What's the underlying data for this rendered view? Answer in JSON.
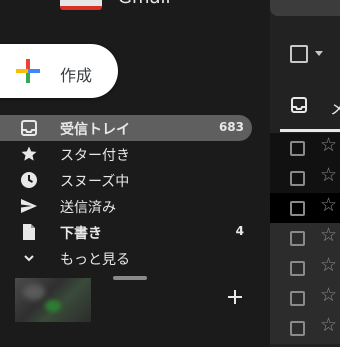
{
  "app": {
    "logo_text": "Gmail"
  },
  "compose": {
    "label": "作成"
  },
  "nav": {
    "items": [
      {
        "label": "受信トレイ",
        "count": "683",
        "active": true,
        "icon": "inbox-icon"
      },
      {
        "label": "スター付き",
        "count": "",
        "active": false,
        "icon": "star-icon"
      },
      {
        "label": "スヌーズ中",
        "count": "",
        "active": false,
        "icon": "clock-icon"
      },
      {
        "label": "送信済み",
        "count": "",
        "active": false,
        "icon": "send-icon"
      },
      {
        "label": "下書き",
        "count": "4",
        "active": false,
        "icon": "draft-icon"
      },
      {
        "label": "もっと見る",
        "count": "",
        "active": false,
        "icon": "chevron-down-icon"
      }
    ]
  },
  "hangouts": {
    "add_icon": "plus-icon"
  },
  "list": {
    "tab_label": "メ",
    "tab_icon": "inbox-icon",
    "row_count": 7
  },
  "colors": {
    "background": "#1b1b1b",
    "active_item": "#5f5f5f",
    "compose_bg": "#ffffff",
    "text": "#e8e8e8"
  }
}
